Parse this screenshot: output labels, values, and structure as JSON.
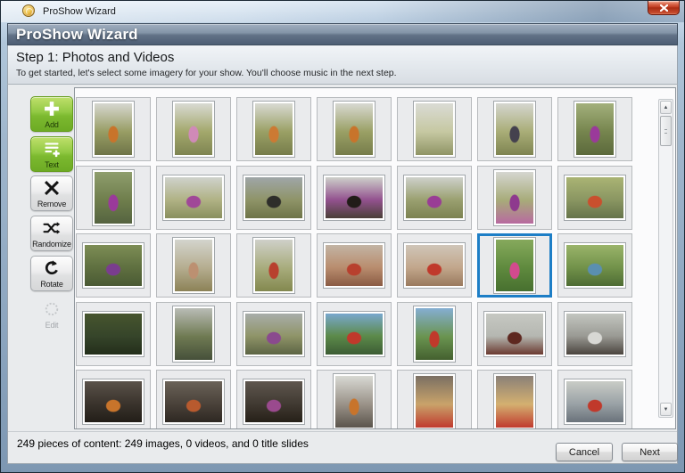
{
  "window": {
    "title": "ProShow Wizard"
  },
  "header": {
    "title": "ProShow Wizard"
  },
  "step": {
    "title": "Step 1: Photos and Videos",
    "subtitle": "To get started, let's select some imagery for your show. You'll choose music in the next step."
  },
  "toolbar": {
    "buttons": [
      {
        "id": "add",
        "label": "Add",
        "style": "green",
        "icon": "plus-icon"
      },
      {
        "id": "text",
        "label": "Text",
        "style": "green",
        "icon": "text-plus-icon"
      },
      {
        "id": "remove",
        "label": "Remove",
        "style": "gray",
        "icon": "x-icon"
      },
      {
        "id": "randomize",
        "label": "Randomize",
        "style": "gray",
        "icon": "shuffle-icon"
      },
      {
        "id": "rotate",
        "label": "Rotate",
        "style": "gray",
        "icon": "rotate-icon"
      },
      {
        "id": "edit",
        "label": "Edit",
        "style": "disabled",
        "icon": "gear-icon"
      }
    ]
  },
  "grid": {
    "columns": 7,
    "rows_visible": 5,
    "selected_index": 19,
    "cells": [
      {
        "o": "p",
        "c": [
          "#d6d7d0",
          "#989d64",
          "#6e7448"
        ],
        "f": "#c8742b"
      },
      {
        "o": "p",
        "c": [
          "#d9dad3",
          "#a3a86c",
          "#7e8451"
        ],
        "f": "#d08ab8"
      },
      {
        "o": "p",
        "c": [
          "#d9dad3",
          "#9aa065",
          "#767c4b"
        ],
        "f": "#cc7a33"
      },
      {
        "o": "p",
        "c": [
          "#d8d9d2",
          "#9aa065",
          "#767c4b"
        ],
        "f": "#c8742b"
      },
      {
        "o": "p",
        "c": [
          "#dadbd5",
          "#c6c8a2",
          "#8f9465"
        ],
        "f": null
      },
      {
        "o": "p",
        "c": [
          "#d5d6cf",
          "#a9ad77",
          "#7e8451"
        ],
        "f": "#44414e"
      },
      {
        "o": "p",
        "c": [
          "#a3b07c",
          "#76854e",
          "#5b693c"
        ],
        "f": "#9a3a9a"
      },
      {
        "o": "p",
        "c": [
          "#8f9e6d",
          "#6f7e4c",
          "#556340"
        ],
        "f": "#9a3a9a"
      },
      {
        "o": "l",
        "c": [
          "#cfd2cc",
          "#b0b285",
          "#8a8f5e"
        ],
        "f": "#a04898"
      },
      {
        "o": "l",
        "c": [
          "#9fa6a8",
          "#8f9468",
          "#6e7448"
        ],
        "f": "#2e2e2a"
      },
      {
        "o": "l",
        "c": [
          "#cdd0ca",
          "#93528f",
          "#4a4038"
        ],
        "f": "#211c18"
      },
      {
        "o": "l",
        "c": [
          "#ced1cb",
          "#9aa070",
          "#7c8251"
        ],
        "f": "#993d95"
      },
      {
        "o": "p",
        "c": [
          "#d5d6d0",
          "#a7ab79",
          "#b86aa0"
        ],
        "f": "#8e3a8e"
      },
      {
        "o": "l",
        "c": [
          "#aab474",
          "#8a9662",
          "#66744a"
        ],
        "f": "#c9502e"
      },
      {
        "o": "l",
        "c": [
          "#7d8d55",
          "#5f7040",
          "#4a5a34"
        ],
        "f": "#7a3d8e"
      },
      {
        "o": "p",
        "c": [
          "#d3d4cd",
          "#b5ad8f",
          "#8c8257"
        ],
        "f": "#bc9071"
      },
      {
        "o": "p",
        "c": [
          "#cfd0c9",
          "#a8ac7c",
          "#83884f"
        ],
        "f": "#b8402e"
      },
      {
        "o": "l",
        "c": [
          "#c2b4a4",
          "#b98d6e",
          "#8a5b44"
        ],
        "f": "#b8402e"
      },
      {
        "o": "l",
        "c": [
          "#cfc5b8",
          "#c2a78c",
          "#9a7a5e"
        ],
        "f": "#c0392b"
      },
      {
        "o": "p",
        "c": [
          "#86a95c",
          "#5f8a3e",
          "#47702f"
        ],
        "f": "#d24a8e"
      },
      {
        "o": "l",
        "c": [
          "#9ab46a",
          "#72924a",
          "#4e6c34"
        ],
        "f": "#5a8fb0"
      },
      {
        "o": "l",
        "c": [
          "#47552e",
          "#36452a",
          "#232e1a"
        ],
        "f": null
      },
      {
        "o": "p",
        "c": [
          "#b9bcb6",
          "#6f7a52",
          "#46503a"
        ],
        "f": null
      },
      {
        "o": "l",
        "c": [
          "#a9aeaa",
          "#8f9468",
          "#5c6444"
        ],
        "f": "#8a4a8e"
      },
      {
        "o": "l",
        "c": [
          "#79a8ce",
          "#5c8a4a",
          "#3c5c34"
        ],
        "f": "#c0392b"
      },
      {
        "o": "p",
        "c": [
          "#85aed2",
          "#6a9450",
          "#44602f"
        ],
        "f": "#c0392b"
      },
      {
        "o": "l",
        "c": [
          "#c6c8c2",
          "#b5b7b1",
          "#6a3a30"
        ],
        "f": "#5e2820"
      },
      {
        "o": "l",
        "c": [
          "#c3c6c0",
          "#9a9a94",
          "#4a443e"
        ],
        "f": "#d8d8d4"
      },
      {
        "o": "l",
        "c": [
          "#5a524a",
          "#3a332c",
          "#221e18"
        ],
        "f": "#c8742b"
      },
      {
        "o": "l",
        "c": [
          "#6a6258",
          "#4a423a",
          "#2e2822"
        ],
        "f": "#b85a2e"
      },
      {
        "o": "l",
        "c": [
          "#5e564e",
          "#413a32",
          "#262018"
        ],
        "f": "#9a4a8e"
      },
      {
        "o": "p",
        "c": [
          "#d8d9d4",
          "#9a9288",
          "#5a544c"
        ],
        "f": "#c8742b"
      },
      {
        "o": "p",
        "c": [
          "#7a6f63",
          "#c9a36a",
          "#c03a2e"
        ],
        "f": null
      },
      {
        "o": "p",
        "c": [
          "#8a8078",
          "#d4b070",
          "#c03a2e"
        ],
        "f": null
      },
      {
        "o": "l",
        "c": [
          "#c9ccc6",
          "#9aa2a6",
          "#6a727a"
        ],
        "f": "#c0392b"
      }
    ]
  },
  "status": {
    "text": "249 pieces of content: 249 images, 0 videos, and 0 title slides"
  },
  "footer": {
    "cancel_label": "Cancel",
    "next_label": "Next"
  },
  "colors": {
    "selection": "#1d7ec6",
    "accent_green": "#7cb92f"
  }
}
